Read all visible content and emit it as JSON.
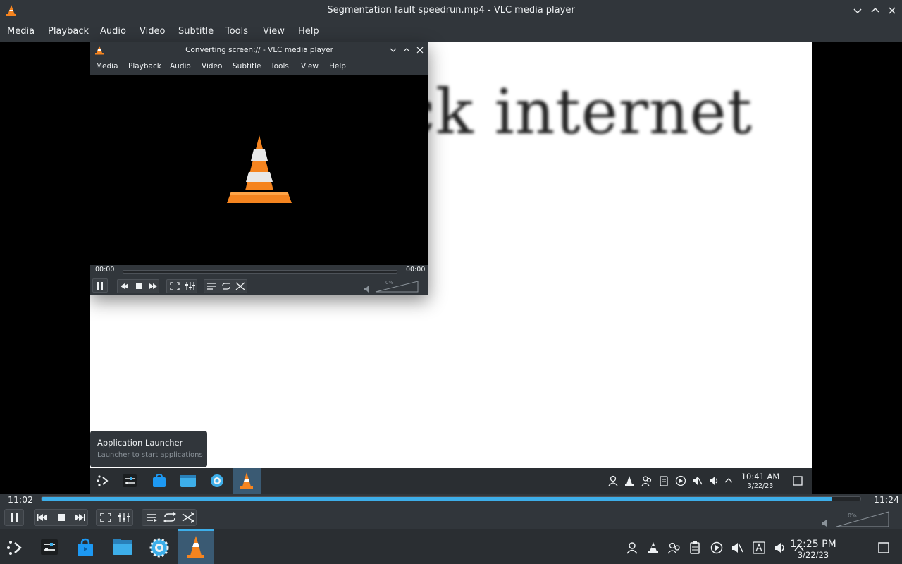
{
  "window": {
    "title": "Segmentation fault speedrun.mp4 - VLC media player",
    "menu": [
      "Media",
      "Playback",
      "Audio",
      "Video",
      "Subtitle",
      "Tools",
      "View",
      "Help"
    ]
  },
  "video_content": {
    "headline": "ck internet",
    "tooltip_title": "Application Launcher",
    "tooltip_subtitle": "Launcher to start applications",
    "captured_clock_time": "10:41 AM",
    "captured_clock_date": "3/22/23"
  },
  "converting_window": {
    "title": "Converting screen:// - VLC media player",
    "menu": [
      "Media",
      "Playback",
      "Audio",
      "Video",
      "Subtitle",
      "Tools",
      "View",
      "Help"
    ],
    "time_elapsed": "00:00",
    "time_total": "00:00",
    "volume_label": "0%"
  },
  "controls": {
    "time_elapsed": "11:02",
    "time_total": "11:24",
    "progress_fraction": 0.965,
    "volume_label": "0%"
  },
  "taskbar": {
    "clock_time": "12:25 PM",
    "clock_date": "3/22/23"
  },
  "colors": {
    "accent": "#3daee9",
    "chrome": "#31363b",
    "taskbar": "#2a2e32",
    "vlc_orange": "#f5841f"
  }
}
